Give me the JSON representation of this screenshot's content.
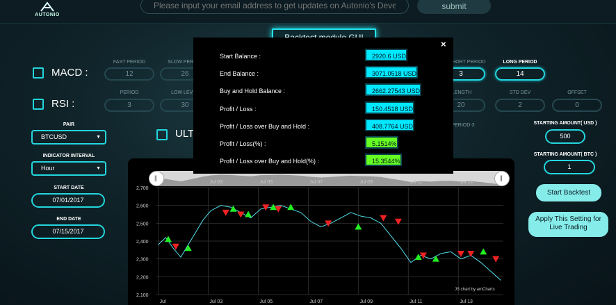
{
  "header": {
    "logo_text": "AUTONIO",
    "email_placeholder": "Please input your email address to get updates on Autonio's Developme",
    "submit_label": "submit"
  },
  "gui_title": "Backtest module GUI",
  "indicators": {
    "macd": {
      "label": "MACD :",
      "params": [
        {
          "label": "FAST PERIOD",
          "value": "12"
        },
        {
          "label": "SLOW PERIOD",
          "value": "26"
        }
      ]
    },
    "rsi": {
      "label": "RSI :",
      "params": [
        {
          "label": "PERIOD",
          "value": "3"
        },
        {
          "label": "LOW LEVEL",
          "value": "30"
        }
      ]
    },
    "ultimate": {
      "label": "ULTIMATE"
    },
    "right_params": [
      {
        "label": "SHORT PERIOD",
        "value": "3"
      },
      {
        "label": "LONG PERIOD",
        "value": "14"
      }
    ],
    "bb_params": [
      {
        "label": "LENGTH",
        "value": "20"
      },
      {
        "label": "STD DEV",
        "value": "2"
      },
      {
        "label": "OFFSET",
        "value": "0"
      }
    ],
    "period3_label": "PERIOD-3"
  },
  "settings": {
    "pair": {
      "label": "PAIR",
      "value": "BTCUSD"
    },
    "interval": {
      "label": "INDICATOR INTERVAL",
      "value": "Hour"
    },
    "start_date": {
      "label": "START DATE",
      "value": "07/01/2017"
    },
    "end_date": {
      "label": "END DATE",
      "value": "07/15/2017"
    },
    "starting_usd": {
      "label": "STARTING AMOUNT( USD )",
      "value": "500"
    },
    "starting_btc": {
      "label": "STARTING AMOUNT( BTC )",
      "value": "1"
    },
    "start_backtest_label": "Start Backtest",
    "apply_live_label": "Apply This Setting for Live Trading"
  },
  "results": {
    "close_symbol": "×",
    "rows": [
      {
        "label": "Start Balance :",
        "value": "2920.6 USD",
        "color": "cyan"
      },
      {
        "label": "End Balance :",
        "value": "3071.0518 USD",
        "color": "cyan"
      },
      {
        "label": "Buy and Hold Balance :",
        "value": "2662.27543 USD",
        "color": "cyan"
      },
      {
        "label": "Profit / Loss :",
        "value": "150.4518 USD",
        "color": "cyan"
      },
      {
        "label": "Profit / Loss over Buy and Hold :",
        "value": "408.7764 USD",
        "color": "cyan"
      },
      {
        "label": "Profit / Loss(%) :",
        "value": "5.1514%",
        "color": "green"
      },
      {
        "label": "Profit / Loss over Buy and Hold(%) :",
        "value": "15.3544%",
        "color": "green"
      }
    ]
  },
  "chart": {
    "credit": "JS chart by amCharts",
    "y_ticks": [
      "2,700",
      "2,600",
      "2,500",
      "2,400",
      "2,300",
      "2,200",
      "2,100"
    ],
    "x_ticks": [
      "Jul",
      "Jul 03",
      "Jul 05",
      "Jul 07",
      "Jul 09",
      "Jul 11",
      "Jul 13"
    ],
    "scroll_ticks": [
      "Jul 03",
      "Jul 05",
      "Jul 07",
      "Jul 09",
      "Jul 11",
      "Jul 13"
    ],
    "line_color": "#55e0ee",
    "buy_color": "#22ee22",
    "sell_color": "#ee2222"
  },
  "chart_data": {
    "type": "line",
    "ylim": [
      2100,
      2700
    ],
    "price_series": [
      {
        "day": 1.0,
        "price": 2380
      },
      {
        "day": 1.3,
        "price": 2420
      },
      {
        "day": 1.6,
        "price": 2360
      },
      {
        "day": 1.9,
        "price": 2310
      },
      {
        "day": 2.2,
        "price": 2380
      },
      {
        "day": 2.5,
        "price": 2450
      },
      {
        "day": 2.8,
        "price": 2520
      },
      {
        "day": 3.1,
        "price": 2570
      },
      {
        "day": 3.5,
        "price": 2600
      },
      {
        "day": 3.9,
        "price": 2590
      },
      {
        "day": 4.3,
        "price": 2560
      },
      {
        "day": 4.7,
        "price": 2530
      },
      {
        "day": 5.1,
        "price": 2580
      },
      {
        "day": 5.5,
        "price": 2590
      },
      {
        "day": 5.9,
        "price": 2600
      },
      {
        "day": 6.3,
        "price": 2580
      },
      {
        "day": 6.7,
        "price": 2560
      },
      {
        "day": 7.1,
        "price": 2510
      },
      {
        "day": 7.5,
        "price": 2480
      },
      {
        "day": 7.9,
        "price": 2500
      },
      {
        "day": 8.3,
        "price": 2530
      },
      {
        "day": 8.7,
        "price": 2560
      },
      {
        "day": 9.1,
        "price": 2540
      },
      {
        "day": 9.5,
        "price": 2530
      },
      {
        "day": 9.9,
        "price": 2500
      },
      {
        "day": 10.3,
        "price": 2430
      },
      {
        "day": 10.7,
        "price": 2360
      },
      {
        "day": 11.1,
        "price": 2280
      },
      {
        "day": 11.5,
        "price": 2320
      },
      {
        "day": 11.9,
        "price": 2300
      },
      {
        "day": 12.3,
        "price": 2330
      },
      {
        "day": 12.7,
        "price": 2340
      },
      {
        "day": 13.1,
        "price": 2300
      },
      {
        "day": 13.5,
        "price": 2320
      },
      {
        "day": 13.9,
        "price": 2280
      },
      {
        "day": 14.3,
        "price": 2230
      },
      {
        "day": 14.7,
        "price": 2180
      }
    ],
    "buy_signals": [
      {
        "day": 1.4,
        "price": 2410
      },
      {
        "day": 2.2,
        "price": 2360
      },
      {
        "day": 4.0,
        "price": 2580
      },
      {
        "day": 4.6,
        "price": 2550
      },
      {
        "day": 5.6,
        "price": 2590
      },
      {
        "day": 6.3,
        "price": 2590
      },
      {
        "day": 9.0,
        "price": 2480
      },
      {
        "day": 11.4,
        "price": 2310
      },
      {
        "day": 12.1,
        "price": 2300
      },
      {
        "day": 14.0,
        "price": 2340
      }
    ],
    "sell_signals": [
      {
        "day": 1.7,
        "price": 2370
      },
      {
        "day": 3.7,
        "price": 2560
      },
      {
        "day": 4.3,
        "price": 2550
      },
      {
        "day": 5.3,
        "price": 2590
      },
      {
        "day": 5.8,
        "price": 2580
      },
      {
        "day": 7.8,
        "price": 2500
      },
      {
        "day": 10.0,
        "price": 2530
      },
      {
        "day": 10.6,
        "price": 2510
      },
      {
        "day": 11.6,
        "price": 2320
      },
      {
        "day": 13.1,
        "price": 2330
      },
      {
        "day": 13.5,
        "price": 2330
      },
      {
        "day": 14.5,
        "price": 2300
      }
    ]
  }
}
